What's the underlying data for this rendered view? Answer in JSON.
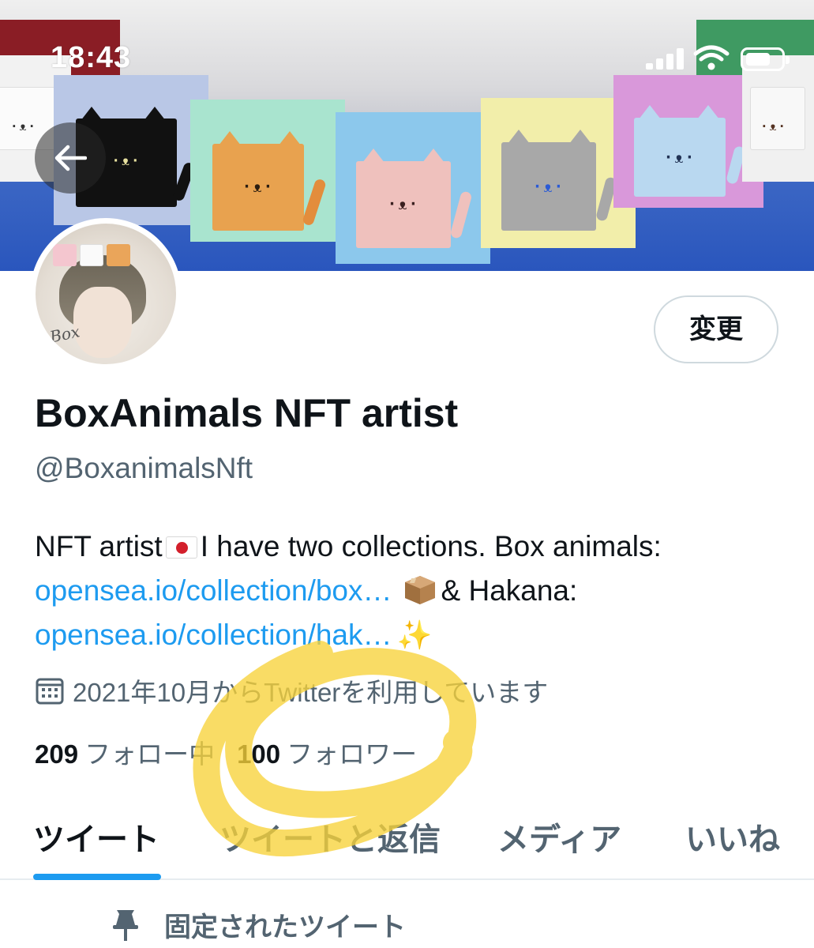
{
  "status_bar": {
    "time": "18:43",
    "icons": [
      "signal-icon",
      "wifi-icon",
      "battery-icon"
    ]
  },
  "banner": {
    "tiles": [
      {
        "bg": "#f2f2f2",
        "box": "#f5f5f5",
        "face": "·ᴥ·"
      },
      {
        "bg": "#b9c7e6",
        "box": "#111111",
        "face": "·ᴥ·"
      },
      {
        "bg": "#a9e4cf",
        "box": "#e8a24f",
        "face": "·ᴥ·"
      },
      {
        "bg": "#8cc8ec",
        "box": "#efc1bd",
        "face": "·ᴥ·"
      },
      {
        "bg": "#f2eeaa",
        "box": "#a8a8a8",
        "face": "·ᴥ·"
      },
      {
        "bg": "#d998da",
        "box": "#b9d8f0",
        "face": "·ᴥ·"
      },
      {
        "bg": "#f0f0f0",
        "box": "#f6f6f6",
        "face": "·ᴥ·"
      }
    ]
  },
  "profile": {
    "edit_label": "変更",
    "avatar_text": "Box",
    "display_name": "BoxAnimals NFT artist",
    "handle": "@BoxanimalsNft",
    "bio": {
      "line1_text": "NFT artist",
      "line1_rest": "I have two collections. Box animals:",
      "link1": "opensea.io/collection/box…",
      "line2_rest": "& Hakana:",
      "link2": "opensea.io/collection/hak…"
    },
    "joined": "2021年10月からTwitterを利用しています",
    "following_count": "209",
    "following_label": "フォロー中",
    "followers_count": "100",
    "followers_label": "フォロワー"
  },
  "tabs": [
    {
      "label": "ツイート",
      "active": true
    },
    {
      "label": "ツイートと返信",
      "active": false
    },
    {
      "label": "メディア",
      "active": false
    },
    {
      "label": "いいね",
      "active": false
    }
  ],
  "pinned": {
    "label": "固定されたツイート"
  },
  "colors": {
    "accent": "#1d9bf0",
    "text": "#0f1419",
    "muted": "#536471",
    "highlighter": "#f7d23a"
  }
}
